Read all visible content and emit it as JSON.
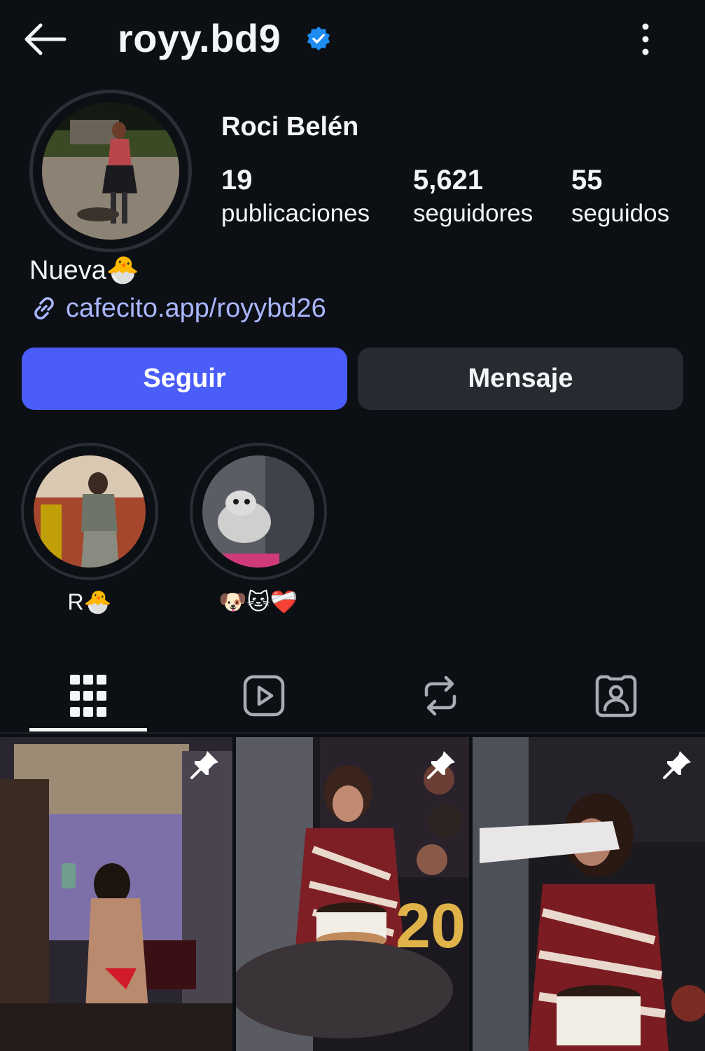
{
  "header": {
    "username": "royy.bd9",
    "back_icon": "arrow-left-icon",
    "verified_icon": "verified-badge-icon",
    "menu_icon": "more-vertical-icon"
  },
  "profile": {
    "full_name": "Roci Belén",
    "stats": [
      {
        "value": "19",
        "label": "publicaciones"
      },
      {
        "value": "5,621",
        "label": "seguidores"
      },
      {
        "value": "55",
        "label": "seguidos"
      }
    ],
    "bio": "Nueva🐣",
    "link": "cafecito.app/royybd26"
  },
  "actions": {
    "follow": "Seguir",
    "message": "Mensaje"
  },
  "highlights": [
    {
      "label": "R🐣"
    },
    {
      "label": "🐶🐱❤️‍🩹"
    }
  ],
  "tabs": [
    "grid-icon",
    "reels-icon",
    "reposts-icon",
    "tagged-icon"
  ],
  "colors": {
    "background": "#0c0f14",
    "accent": "#4a5df9",
    "link": "#a9b6ff",
    "verified": "#1d8cf3",
    "secondary_button": "#262a31"
  }
}
